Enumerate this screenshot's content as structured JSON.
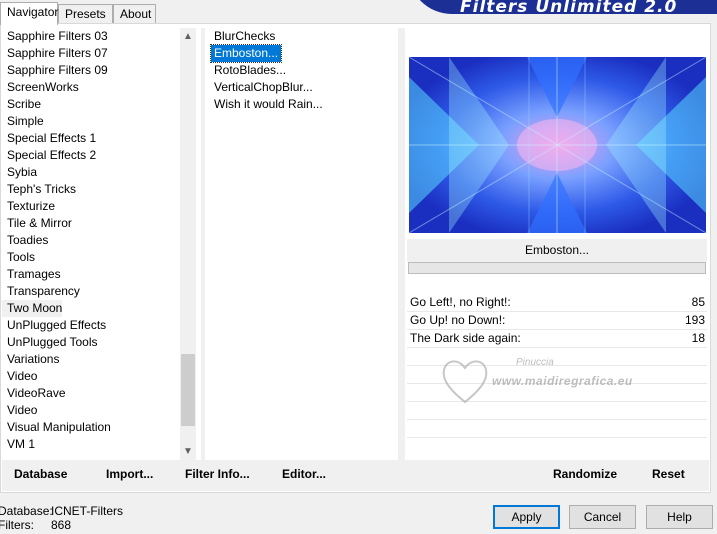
{
  "banner": {
    "title": "Filters Unlimited 2.0"
  },
  "tabs": [
    {
      "label": "Navigator",
      "active": true
    },
    {
      "label": "Presets",
      "active": false
    },
    {
      "label": "About",
      "active": false
    }
  ],
  "categories": [
    "Sapphire Filters 03",
    "Sapphire Filters 07",
    "Sapphire Filters 09",
    "ScreenWorks",
    "Scribe",
    "Simple",
    "Special Effects 1",
    "Special Effects 2",
    "Sybia",
    "Teph's Tricks",
    "Texturize",
    "Tile & Mirror",
    "Toadies",
    "Tools",
    "Tramages",
    "Transparency",
    "Two Moon",
    "UnPlugged Effects",
    "UnPlugged Tools",
    "Variations",
    "Video",
    "VideoRave",
    "Video",
    "Visual Manipulation",
    "VM 1"
  ],
  "selected_category": "Two Moon",
  "filters": [
    "BlurChecks",
    "Emboston...",
    "RotoBlades...",
    "VerticalChopBlur...",
    "Wish it would Rain..."
  ],
  "selected_filter": "Emboston...",
  "preview": {
    "filter_name": "Emboston..."
  },
  "progress": {
    "value": 0
  },
  "params": [
    {
      "label": "Go Left!, no Right!:",
      "value": "85"
    },
    {
      "label": "Go Up! no Down!:",
      "value": "193"
    },
    {
      "label": "The Dark side again:",
      "value": "18"
    }
  ],
  "watermark": {
    "name": "Pinuccia",
    "site": "www.maidiregrafica.eu"
  },
  "bottom": {
    "database_label": "Database",
    "import_label": "Import...",
    "filter_info_label": "Filter Info...",
    "editor_label": "Editor...",
    "randomize_label": "Randomize",
    "reset_label": "Reset"
  },
  "status": {
    "database_label": "Database:",
    "database_value": "ICNET-Filters",
    "filters_label": "Filters:",
    "filters_value": "868"
  },
  "dialog": {
    "apply_label": "Apply",
    "cancel_label": "Cancel",
    "help_label": "Help"
  },
  "colors": {
    "banner": "#1c2f94",
    "selection": "#0078d7"
  }
}
